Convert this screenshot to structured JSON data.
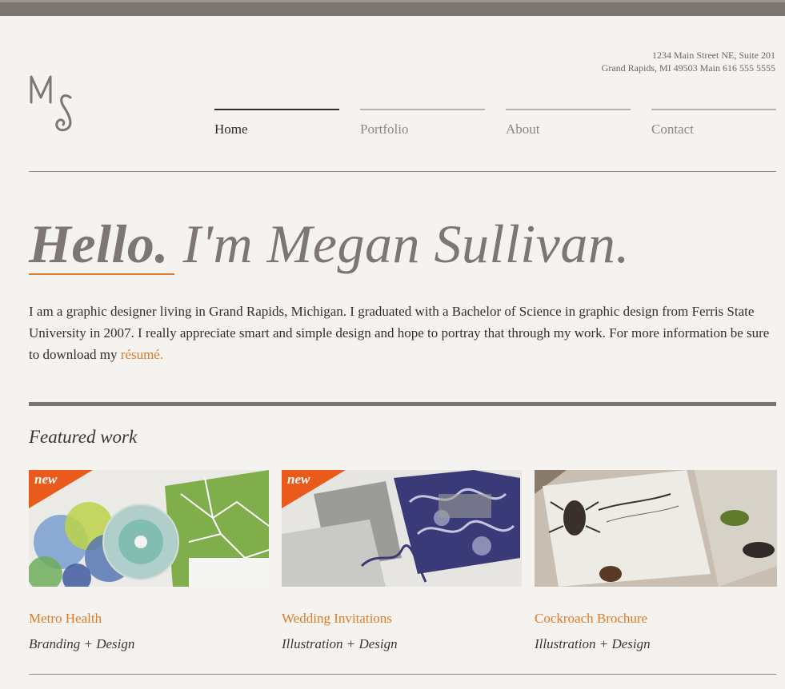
{
  "header": {
    "logo_initials": "MS",
    "address_line1": "1234 Main Street NE, Suite 201",
    "address_line2": "Grand Rapids, MI 49503 Main 616 555 5555"
  },
  "nav": {
    "items": [
      {
        "label": "Home",
        "active": true
      },
      {
        "label": "Portfolio",
        "active": false
      },
      {
        "label": "About",
        "active": false
      },
      {
        "label": "Contact",
        "active": false
      }
    ]
  },
  "hero": {
    "greeting": "Hello.",
    "name_line": " I'm Megan Sullivan."
  },
  "intro": {
    "text": "I am a graphic designer living in Grand Rapids, Michigan. I graduated with a Bachelor of Science in graphic design from Ferris State University in 2007. I really appreciate smart and simple design and hope to portray that through my work. For more information be sure to download my ",
    "link_text": "résumé."
  },
  "featured": {
    "title": "Featured work",
    "items": [
      {
        "title": "Metro Health",
        "subtitle": "Branding + Design",
        "badge": "new"
      },
      {
        "title": "Wedding Invitations",
        "subtitle": "Illustration + Design",
        "badge": "new"
      },
      {
        "title": "Cockroach Brochure",
        "subtitle": "Illustration + Design",
        "badge": ""
      }
    ]
  },
  "colors": {
    "accent": "#e07a24",
    "badge": "#ea5a1a",
    "topbar": "#7b7471",
    "background": "#f4f3ef"
  }
}
